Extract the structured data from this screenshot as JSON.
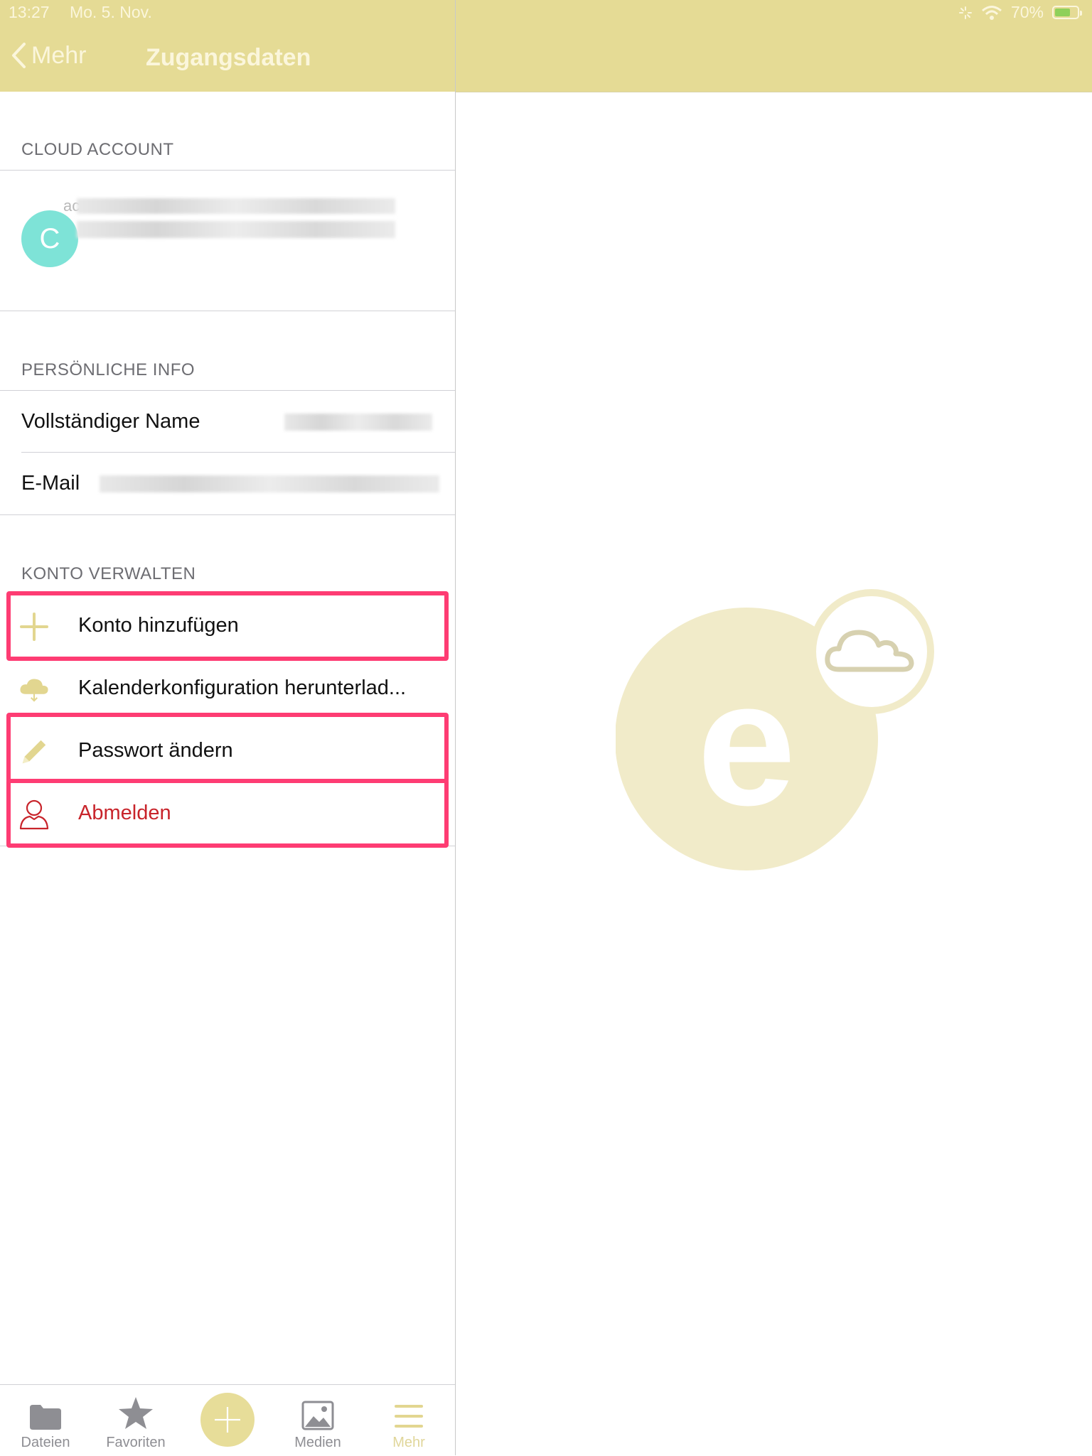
{
  "status_bar": {
    "time": "13:27",
    "date": "Mo. 5. Nov.",
    "battery": "70%",
    "battery_level": 0.7
  },
  "nav": {
    "back_label": "Mehr",
    "title": "Zugangsdaten"
  },
  "cloud_account": {
    "header": "CLOUD ACCOUNT",
    "avatar_letter": "C",
    "hint_letters": "ac"
  },
  "personal_info": {
    "header": "PERSÖNLICHE INFO",
    "full_name_label": "Vollständiger Name",
    "email_label": "E-Mail"
  },
  "manage_account": {
    "header": "KONTO VERWALTEN",
    "add_account": "Konto hinzufügen",
    "download_calendar": "Kalenderkonfiguration herunterlad...",
    "change_password": "Passwort ändern",
    "logout": "Abmelden"
  },
  "tabbar": {
    "files": "Dateien",
    "favorites": "Favoriten",
    "media": "Medien",
    "more": "Mehr"
  },
  "colors": {
    "accent": "#e5db95",
    "highlight": "#fe3c73",
    "logout_red": "#c8242b",
    "avatar": "#7ee3d7"
  },
  "icons": [
    "chevron-left-icon",
    "wifi-icon",
    "battery-icon",
    "plus-icon",
    "cloud-download-icon",
    "pencil-icon",
    "person-icon",
    "folder-icon",
    "star-icon",
    "image-icon",
    "menu-icon",
    "ecloud-logo"
  ]
}
